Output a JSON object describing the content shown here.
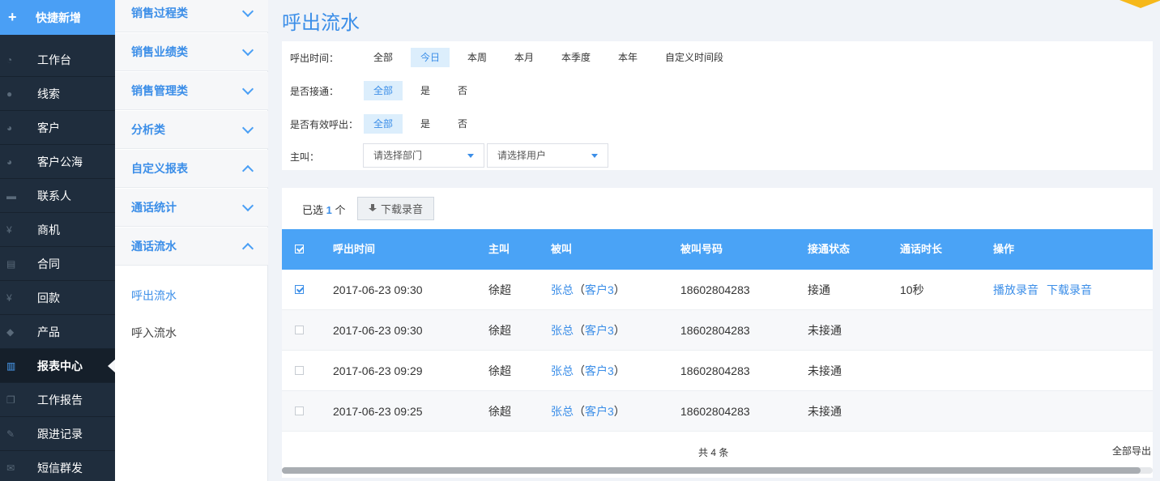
{
  "sidebar": {
    "quick_add": "快捷新增",
    "items": [
      {
        "label": "工作台",
        "icon": "dashboard-icon"
      },
      {
        "label": "线索",
        "icon": "globe-icon"
      },
      {
        "label": "客户",
        "icon": "users-icon"
      },
      {
        "label": "客户公海",
        "icon": "users-group-icon"
      },
      {
        "label": "联系人",
        "icon": "chat-icon"
      },
      {
        "label": "商机",
        "icon": "yen-icon"
      },
      {
        "label": "合同",
        "icon": "document-icon"
      },
      {
        "label": "回款",
        "icon": "yen-icon"
      },
      {
        "label": "产品",
        "icon": "tag-icon"
      },
      {
        "label": "报表中心",
        "icon": "bar-chart-icon",
        "active": true
      },
      {
        "label": "工作报告",
        "icon": "copy-icon"
      },
      {
        "label": "跟进记录",
        "icon": "edit-icon"
      },
      {
        "label": "短信群发",
        "icon": "mail-icon"
      }
    ]
  },
  "report_menu": {
    "groups": [
      {
        "label": "销售过程类",
        "expanded": false
      },
      {
        "label": "销售业绩类",
        "expanded": false
      },
      {
        "label": "销售管理类",
        "expanded": false
      },
      {
        "label": "分析类",
        "expanded": false
      },
      {
        "label": "自定义报表",
        "expanded": true
      },
      {
        "label": "通话统计",
        "expanded": false
      },
      {
        "label": "通话流水",
        "expanded": true
      }
    ],
    "links": [
      {
        "label": "呼出流水",
        "active": true
      },
      {
        "label": "呼入流水",
        "active": false
      }
    ]
  },
  "page_title": "呼出流水",
  "filters": {
    "time_label": "呼出时间：",
    "time_options": [
      "全部",
      "今日",
      "本周",
      "本月",
      "本季度",
      "本年",
      "自定义时间段"
    ],
    "time_selected": "今日",
    "connected_label": "是否接通：",
    "connected_options": [
      "全部",
      "是",
      "否"
    ],
    "valid_label": "是否有效呼出：",
    "valid_options": [
      "全部",
      "是",
      "否"
    ],
    "caller_label": "主叫：",
    "dept_placeholder": "请选择部门",
    "user_placeholder": "请选择用户"
  },
  "toolbar": {
    "selected_prefix": "已选",
    "selected_count": "1",
    "selected_suffix": "个",
    "download_label": "下载录音"
  },
  "table": {
    "columns": [
      "呼出时间",
      "主叫",
      "被叫",
      "被叫号码",
      "接通状态",
      "通话时长",
      "操作"
    ],
    "rows": [
      {
        "checked": true,
        "time": "2017-06-23 09:30",
        "caller": "徐超",
        "callee": "张总",
        "callee_client": "客户3",
        "number": "18602804283",
        "status": "接通",
        "duration": "10秒",
        "play": "播放录音",
        "download": "下载录音"
      },
      {
        "checked": false,
        "time": "2017-06-23 09:30",
        "caller": "徐超",
        "callee": "张总",
        "callee_client": "客户3",
        "number": "18602804283",
        "status": "未接通",
        "duration": "",
        "play": "",
        "download": ""
      },
      {
        "checked": false,
        "time": "2017-06-23 09:29",
        "caller": "徐超",
        "callee": "张总",
        "callee_client": "客户3",
        "number": "18602804283",
        "status": "未接通",
        "duration": "",
        "play": "",
        "download": ""
      },
      {
        "checked": false,
        "time": "2017-06-23 09:25",
        "caller": "徐超",
        "callee": "张总",
        "callee_client": "客户3",
        "number": "18602804283",
        "status": "未接通",
        "duration": "",
        "play": "",
        "download": ""
      }
    ],
    "total": "共 4 条",
    "export_all": "全部导出"
  },
  "colors": {
    "accent": "#4a9ff5",
    "nav_bg": "#1f2d3d",
    "header_bg": "#4aa3f6"
  }
}
